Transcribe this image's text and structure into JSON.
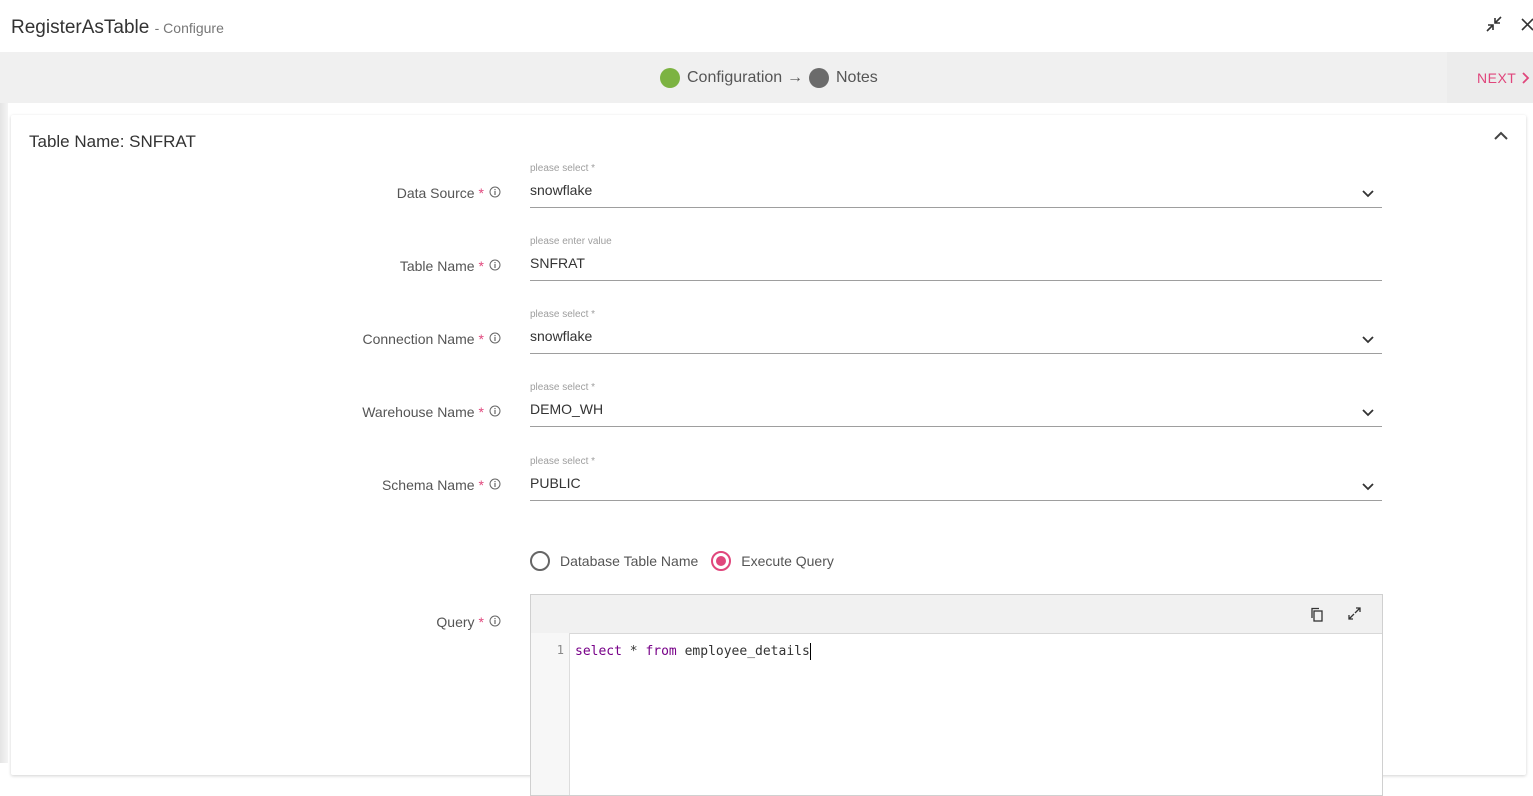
{
  "header": {
    "title": "RegisterAsTable",
    "subtitle": "- Configure"
  },
  "stepper": {
    "steps": [
      {
        "label": "Configuration",
        "status": "active",
        "color": "#7cb342"
      },
      {
        "label": "Notes",
        "status": "inactive",
        "color": "#6b6b6b"
      }
    ],
    "arrow": "→",
    "next_label": "NEXT"
  },
  "panel": {
    "title": "Table Name: SNFRAT"
  },
  "form": {
    "fields": [
      {
        "label": "Data Source",
        "required_mark": "*",
        "placeholder": "please select *",
        "value": "snowflake",
        "type": "select"
      },
      {
        "label": "Table Name",
        "required_mark": "*",
        "placeholder": "please enter value",
        "value": "SNFRAT",
        "type": "text"
      },
      {
        "label": "Connection Name",
        "required_mark": "*",
        "placeholder": "please select *",
        "value": "snowflake",
        "type": "select"
      },
      {
        "label": "Warehouse Name",
        "required_mark": "*",
        "placeholder": "please select *",
        "value": "DEMO_WH",
        "type": "select"
      },
      {
        "label": "Schema Name",
        "required_mark": "*",
        "placeholder": "please select *",
        "value": "PUBLIC",
        "type": "select"
      }
    ],
    "mode": {
      "options": [
        {
          "label": "Database Table Name",
          "selected": false
        },
        {
          "label": "Execute Query",
          "selected": true
        }
      ]
    },
    "query": {
      "label": "Query",
      "required_mark": "*",
      "line_number": "1",
      "code": {
        "kw1": "select",
        "part1": " * ",
        "kw2": "from",
        "part2": " employee_details"
      }
    }
  },
  "colors": {
    "accent": "#e0467c",
    "step_done": "#7cb342",
    "step_pending": "#6b6b6b",
    "keyword": "#770088"
  },
  "icons": {
    "collapse": "collapse-icon",
    "close": "close-icon",
    "next": "chevron-right-icon",
    "panel_toggle": "chevron-up-icon",
    "info": "info-icon",
    "dropdown": "chevron-down-icon",
    "copy": "copy-icon",
    "expand": "expand-icon"
  }
}
